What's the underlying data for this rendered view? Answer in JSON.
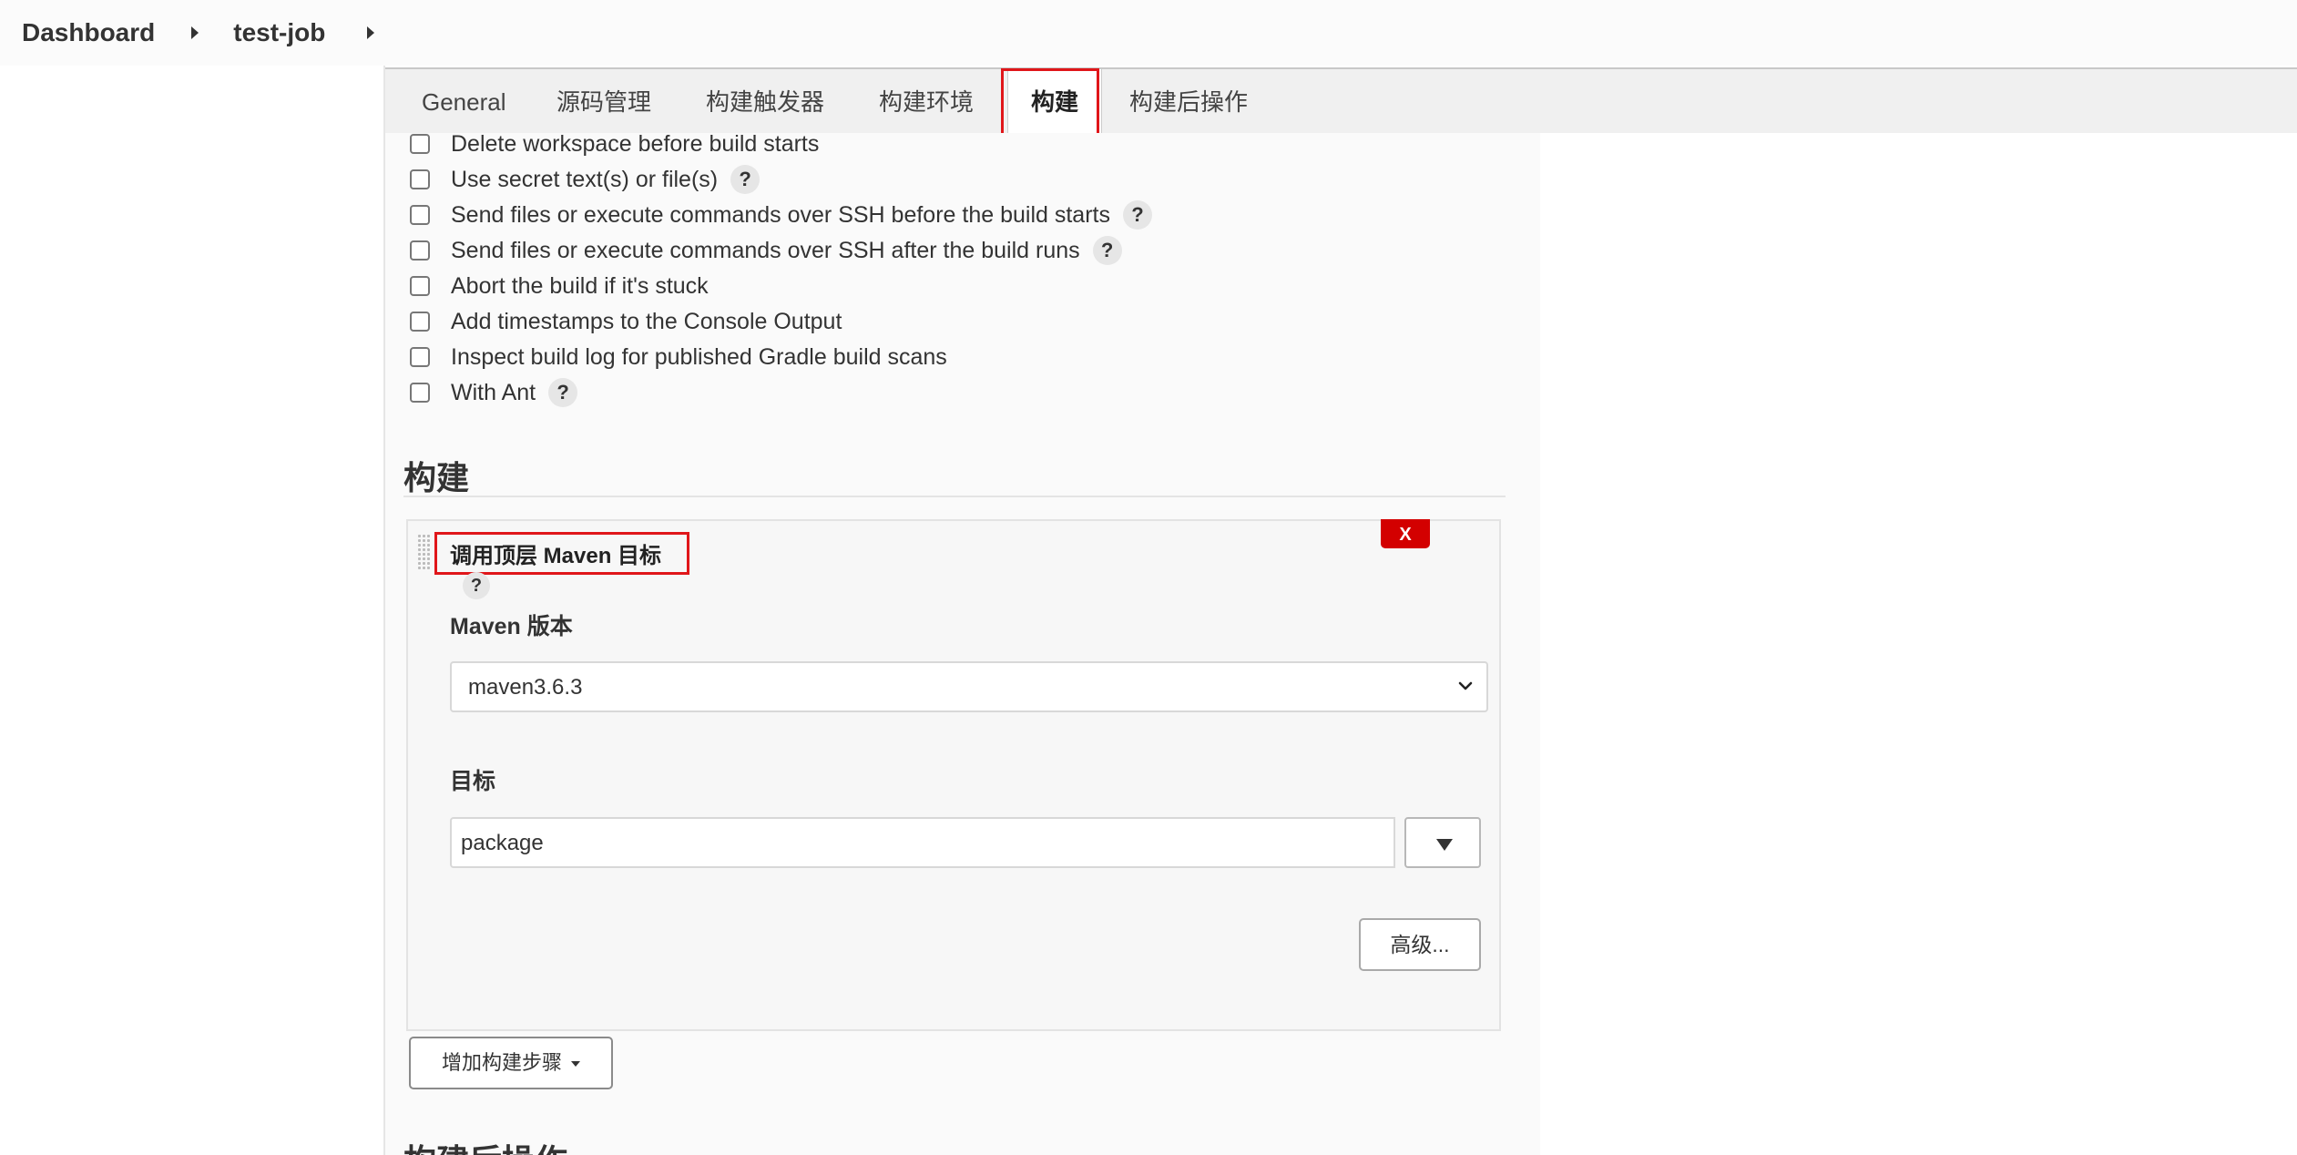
{
  "breadcrumb": {
    "items": [
      "Dashboard",
      "test-job"
    ]
  },
  "tabs": [
    {
      "label": "General"
    },
    {
      "label": "源码管理"
    },
    {
      "label": "构建触发器"
    },
    {
      "label": "构建环境"
    },
    {
      "label": "构建",
      "active": true
    },
    {
      "label": "构建后操作"
    }
  ],
  "build_environment": {
    "options": [
      {
        "label": "Delete workspace before build starts",
        "checked": false,
        "help": false
      },
      {
        "label": "Use secret text(s) or file(s)",
        "checked": false,
        "help": true
      },
      {
        "label": "Send files or execute commands over SSH before the build starts",
        "checked": false,
        "help": true
      },
      {
        "label": "Send files or execute commands over SSH after the build runs",
        "checked": false,
        "help": true
      },
      {
        "label": "Abort the build if it's stuck",
        "checked": false,
        "help": false
      },
      {
        "label": "Add timestamps to the Console Output",
        "checked": false,
        "help": false
      },
      {
        "label": "Inspect build log for published Gradle build scans",
        "checked": false,
        "help": false
      },
      {
        "label": "With Ant",
        "checked": false,
        "help": true
      }
    ],
    "help_glyph": "?"
  },
  "build_section": {
    "title": "构建",
    "step": {
      "title": "调用顶层 Maven 目标",
      "delete_label": "X",
      "maven_version_label": "Maven 版本",
      "maven_version_value": "maven3.6.3",
      "goals_label": "目标",
      "goals_value": "package",
      "advanced_label": "高级..."
    },
    "add_step_label": "增加构建步骤"
  },
  "post_build_section": {
    "title": "构建后操作"
  },
  "colors": {
    "highlight": "#e0161a",
    "delete": "#d30000"
  }
}
